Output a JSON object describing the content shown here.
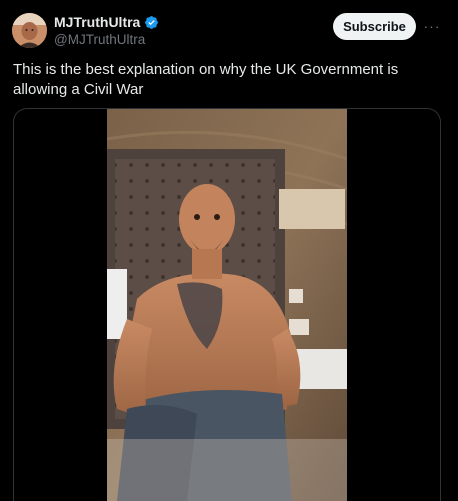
{
  "author": {
    "display_name": "MJTruthUltra",
    "handle": "@MJTruthUltra",
    "verified": true,
    "avatar_icon": "profile-avatar"
  },
  "actions": {
    "subscribe_label": "Subscribe",
    "more_label": "···"
  },
  "post": {
    "text": "This is the best explanation on why the UK Government is allowing a Civil War"
  },
  "media": {
    "type": "video",
    "description_icon": "video-thumbnail"
  },
  "colors": {
    "background": "#000000",
    "primary_text": "#e7e9ea",
    "secondary_text": "#71767b",
    "verified_blue": "#1d9bf0",
    "button_bg": "#eff3f4",
    "border": "#2f3336"
  }
}
